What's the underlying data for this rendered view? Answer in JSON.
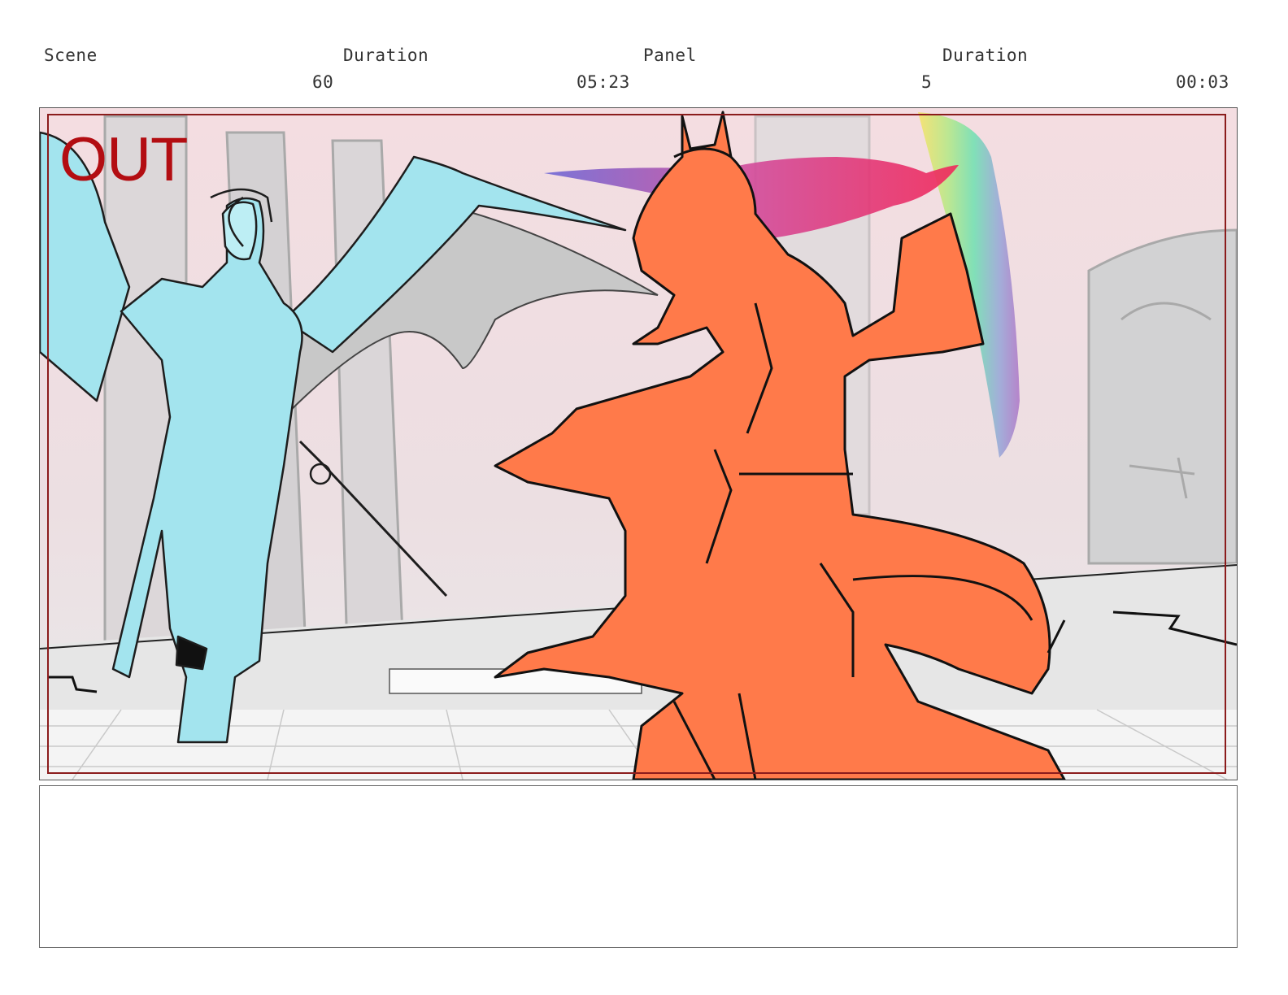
{
  "header": {
    "scene_label": "Scene",
    "scene_duration_label": "Duration",
    "panel_label": "Panel",
    "panel_duration_label": "Duration",
    "scene_value": "60",
    "scene_duration_value": "05:23",
    "panel_value": "5",
    "panel_duration_value": "00:03"
  },
  "panel_image": {
    "overlay_text": "OUT",
    "colors": {
      "frame_border": "#8b1c1c",
      "left_character": "#a3e4ee",
      "right_character": "#ff7a4a",
      "background_sky": "#f3dfe2",
      "background_buildings": "#cfcfcf",
      "out_label": "#b30d12"
    }
  },
  "notes": {
    "text": ""
  }
}
